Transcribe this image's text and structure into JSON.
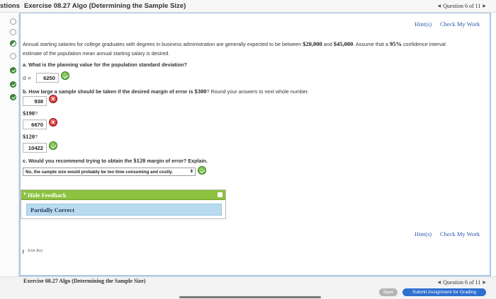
{
  "header": {
    "nav_title": "stions",
    "exercise_title": "Exercise 08.27 Algo (Determining the Sample Size)",
    "question_nav": "Question 6 of 11"
  },
  "toolbar": {
    "hint_label": "Hint(s)",
    "check_label": "Check My Work"
  },
  "question": {
    "intro_line1_a": "Annual starting salaries for college graduates with degrees in business administration are generally expected to be between ",
    "low_salary": "$20,000",
    "and_word": "and",
    "high_salary": "$45,000",
    "intro_line1_b": ". Assume that a ",
    "confidence": "95%",
    "intro_line1_c": " confidence interval",
    "intro_line2": "estimate of the population mean annual starting salary is desired.",
    "part_a": "a. What is the planning value for the population standard deviation?",
    "sigma_label": "σ =",
    "sigma_value": "6250",
    "part_b_a": "b. How large a sample should be taken if the desired margin of error is ",
    "part_b_margin": "$300",
    "part_b_b": "? Round your answers to next whole number.",
    "answer_300": "938",
    "margin_190": "$190",
    "q_mark": "?",
    "answer_190": "6670",
    "margin_120": "$120",
    "answer_120": "10422",
    "part_c_a": "c. Would you recommend trying to obtain the ",
    "part_c_margin": "$120",
    "part_c_b": " margin of error? Explain.",
    "part_c_selected": "No, the sample size would probably be too time consuming and costly."
  },
  "feedback": {
    "title": "Hide Feedback",
    "status": "Partially Correct"
  },
  "icon_key": "Icon Key",
  "footer": {
    "exercise_title": "Exercise 08.27 Algo (Determining the Sample Size)",
    "question_nav": "Question 6 of 11",
    "save_label": "Save",
    "submit_label": "Submit Assignment for Grading"
  },
  "colors": {
    "link": "#2b5aa6",
    "feedback_green": "#8cc23f",
    "feedback_body": "#b9dbf0",
    "submit_blue": "#2f6fd0",
    "panel_border": "#a9c8ea"
  }
}
